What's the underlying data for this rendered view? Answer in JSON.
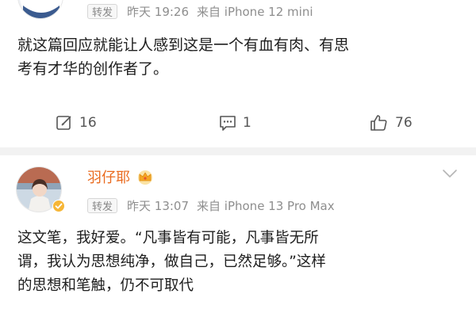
{
  "post1": {
    "repost_badge": "转发",
    "time": "昨天 19:26",
    "source": "来自 iPhone 12 mini",
    "text_lines": [
      "就这篇回应就能让人感到这是一个有血有肉、有思",
      "考有才华的创作者了。"
    ],
    "repost_count": "16",
    "comment_count": "1",
    "like_count": "76"
  },
  "post2": {
    "username": "羽仔耶",
    "repost_badge": "转发",
    "time": "昨天 13:07",
    "source": "来自 iPhone 13 Pro Max",
    "text_lines": [
      "这文笔，我好爱。“凡事皆有可能，凡事皆无所",
      "谓，我认为思想纯净，做自己，已然足够。”这样",
      "的思想和笔触，仍不可取代"
    ]
  },
  "icons": {
    "repost": "repost-icon",
    "comment": "comment-icon",
    "like": "thumbs-up-icon",
    "crown": "crown-icon",
    "verified": "verified-badge-icon",
    "more": "chevron-down-icon"
  },
  "colors": {
    "username": "#e96a1e",
    "meta_text": "#8e8e8e",
    "body_text": "#1e1e1e",
    "divider": "#f2f2f2"
  }
}
